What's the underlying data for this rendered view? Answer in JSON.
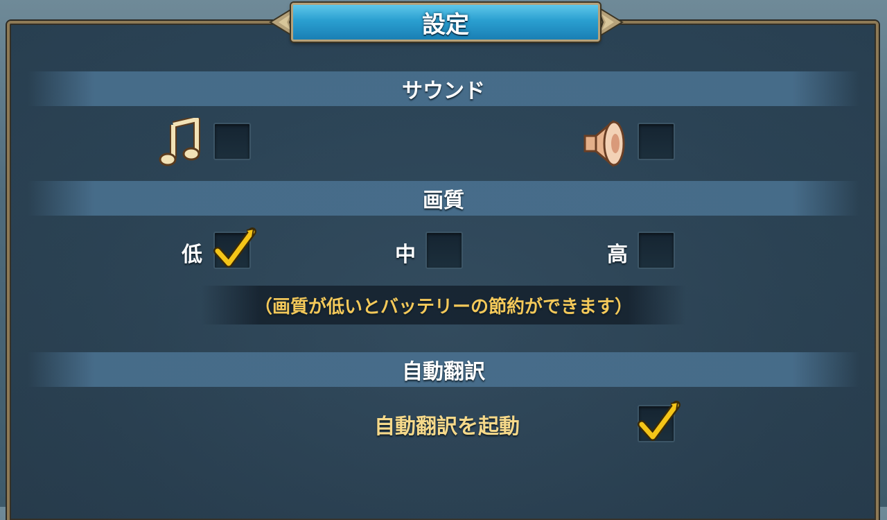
{
  "title": "設定",
  "sound": {
    "heading": "サウンド",
    "music_checked": false,
    "effects_checked": false
  },
  "quality": {
    "heading": "画質",
    "options": [
      {
        "label": "低",
        "checked": true
      },
      {
        "label": "中",
        "checked": false
      },
      {
        "label": "高",
        "checked": false
      }
    ],
    "note": "（画質が低いとバッテリーの節約ができます）"
  },
  "translation": {
    "heading": "自動翻訳",
    "option_label": "自動翻訳を起動",
    "checked": true
  },
  "colors": {
    "accent_gold": "#f4c95a",
    "title_blue": "#2a9fd0",
    "frame_bronze": "#8e7a56"
  },
  "icons": [
    "music-note-icon",
    "speaker-icon",
    "checkmark-icon"
  ]
}
